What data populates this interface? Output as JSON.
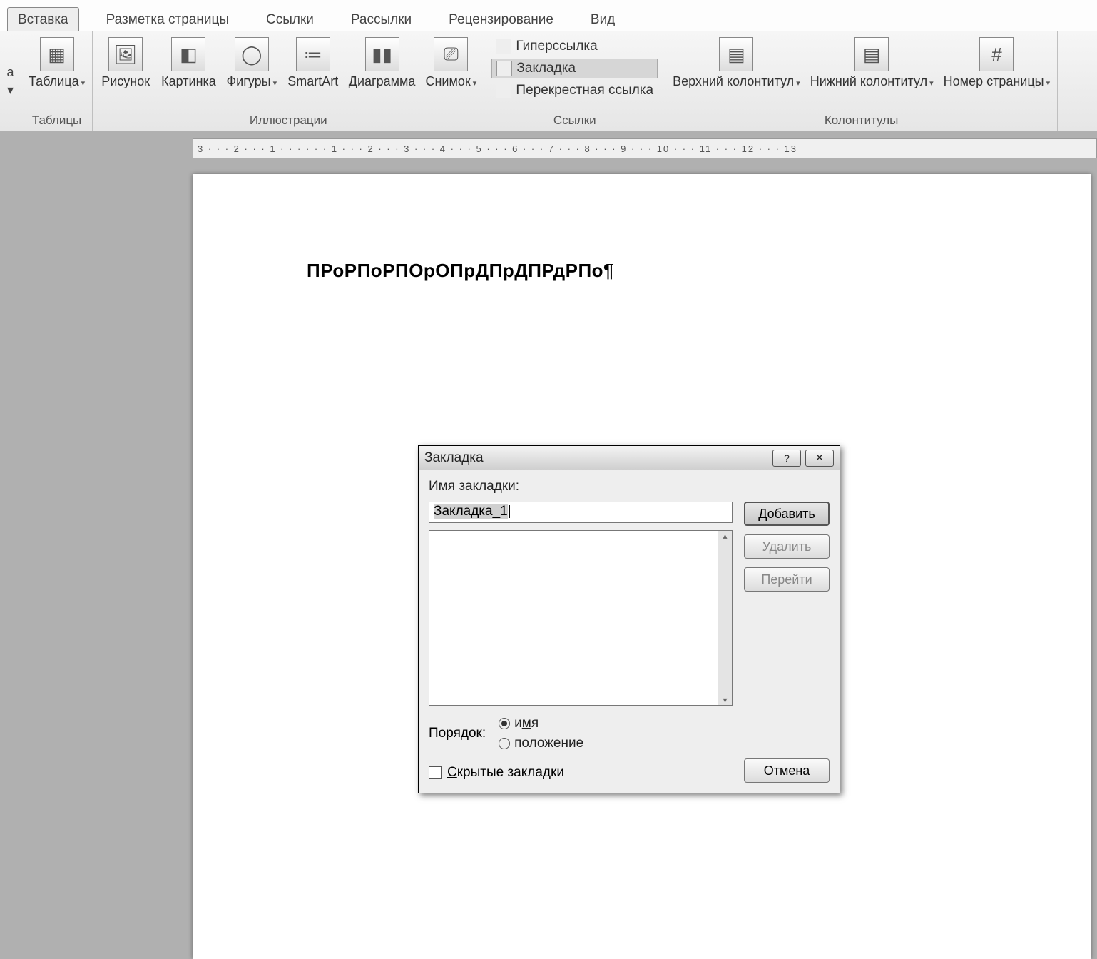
{
  "tabs": {
    "active": "Вставка",
    "items": [
      "Вставка",
      "Разметка страницы",
      "Ссылки",
      "Рассылки",
      "Рецензирование",
      "Вид"
    ]
  },
  "ribbon": {
    "left_trunc": "а",
    "tables": {
      "label": "Таблицы",
      "item": "Таблица"
    },
    "illus": {
      "label": "Иллюстрации",
      "items": [
        "Рисунок",
        "Картинка",
        "Фигуры",
        "SmartArt",
        "Диаграмма",
        "Снимок"
      ]
    },
    "links": {
      "label": "Ссылки",
      "hyperlink": "Гиперссылка",
      "bookmark": "Закладка",
      "crossref": "Перекрестная ссылка"
    },
    "hf": {
      "label": "Колонтитулы",
      "header": "Верхний колонтитул",
      "footer": "Нижний колонтитул",
      "pagenum": "Номер страницы"
    }
  },
  "ruler": "3 · · · 2 · · · 1 · · ·  · · · 1 · · · 2 · · · 3 · · · 4 · · · 5 · · · 6 · · · 7 · · · 8 · · · 9 · · · 10 · · · 11 · · · 12 · · · 13",
  "doc_text": "ПРоРПоРПОрОПрДПрДПРдРПо¶",
  "dialog": {
    "title": "Закладка",
    "name_label": "Имя закладки:",
    "name_value": "Закладка_1",
    "add": "Добавить",
    "delete": "Удалить",
    "goto": "Перейти",
    "order_label": "Порядок:",
    "order_name": "имя",
    "order_pos": "положение",
    "hidden": "Скрытые закладки",
    "cancel": "Отмена"
  }
}
